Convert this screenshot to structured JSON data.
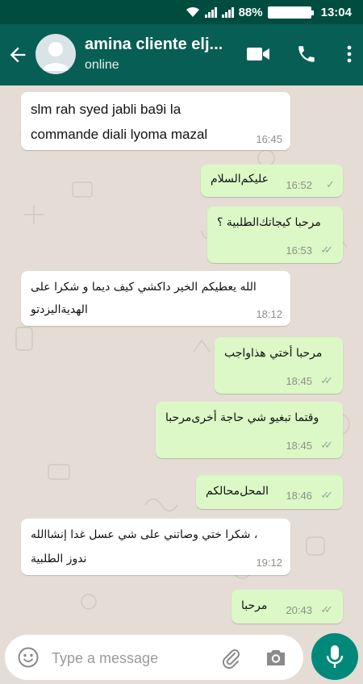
{
  "status_bar": {
    "battery_percent": "88%",
    "time": "13:04"
  },
  "header": {
    "contact_name": "amina cliente elj...",
    "presence": "online"
  },
  "messages": [
    {
      "direction": "in",
      "lines": [
        "slm rah syed jabli ba9i la",
        "commande diali lyoma mazal"
      ],
      "time": "16:45"
    },
    {
      "direction": "out",
      "lines": [
        "عليكم‌السلام"
      ],
      "time": "16:52",
      "status": "sent"
    },
    {
      "direction": "out",
      "lines": [
        "مرحبا كيجاتك‌الطلبية ؟"
      ],
      "time": "16:53",
      "status": "delivered"
    },
    {
      "direction": "in",
      "lines": [
        "الله يعطيكم الخير داكشي كيف ديما و شكرا على",
        "الهدية‌اليزدتو"
      ],
      "time": "18:12"
    },
    {
      "direction": "out",
      "lines": [
        "مرحبا أختي هذاواجب"
      ],
      "time": "18:45",
      "status": "delivered"
    },
    {
      "direction": "out",
      "lines": [
        "وقتما تبغيو شي حاجة أخرى‌مرحبا"
      ],
      "time": "18:45",
      "status": "delivered"
    },
    {
      "direction": "out",
      "lines": [
        "المحل‌محالكم"
      ],
      "time": "18:46",
      "status": "delivered"
    },
    {
      "direction": "in",
      "lines": [
        "، شكرا ختي وصاتني على شي عسل غدا إنشاالله",
        "ندوز الطلبية"
      ],
      "time": "19:12"
    },
    {
      "direction": "out",
      "lines": [
        "مرحبا"
      ],
      "time": "20:43",
      "status": "delivered"
    }
  ],
  "composer": {
    "placeholder": "Type a message"
  },
  "icons": {
    "back": "arrow-left-icon",
    "avatar": "default-avatar-icon",
    "video_call": "video-camera-icon",
    "voice_call": "phone-icon",
    "menu": "more-vert-icon",
    "emoji": "emoji-icon",
    "attach": "paperclip-icon",
    "camera": "camera-icon",
    "mic": "microphone-icon",
    "wifi": "wifi-icon",
    "signal": "signal-icon",
    "battery": "battery-icon"
  },
  "colors": {
    "app_bar": "#075e54",
    "status_bar": "#004d40",
    "chat_bg": "#e5ddd5",
    "incoming_bubble": "#ffffff",
    "outgoing_bubble": "#dcf8c6",
    "mic_button": "#00897b"
  }
}
